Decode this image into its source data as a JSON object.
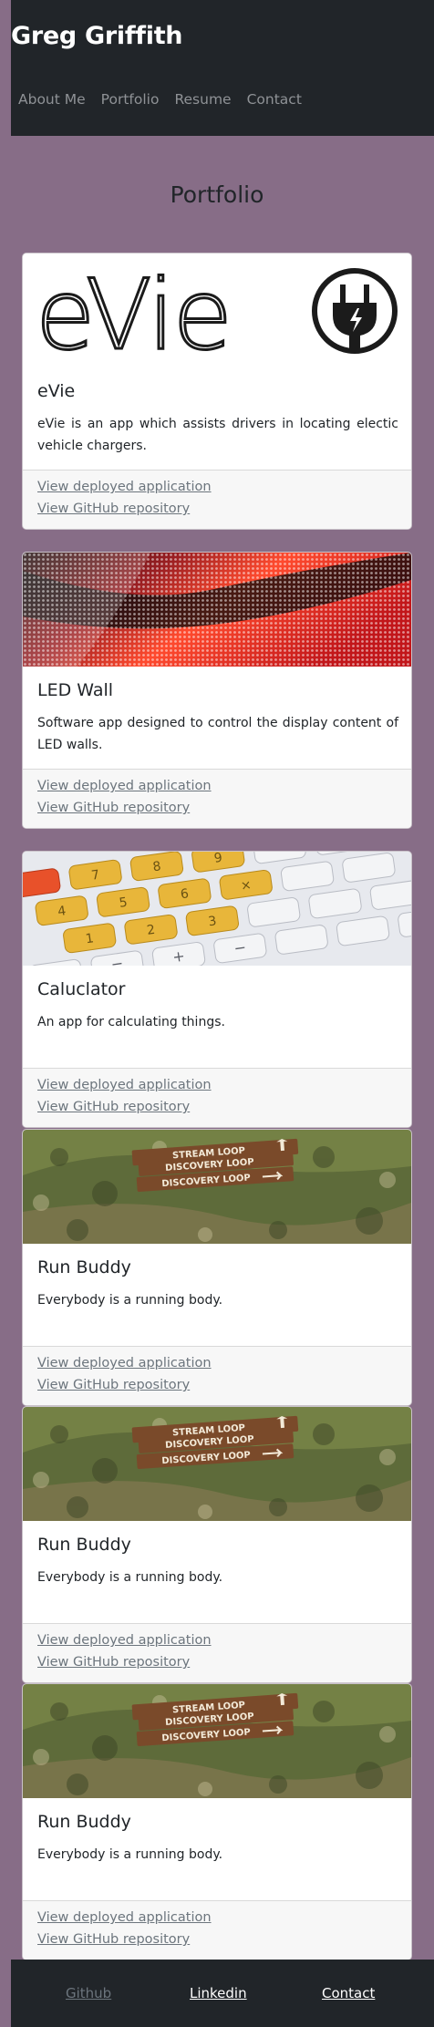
{
  "header": {
    "title": "Greg Griffith",
    "nav": [
      "About Me",
      "Portfolio",
      "Resume",
      "Contact"
    ]
  },
  "section_title": "Portfolio",
  "projects": [
    {
      "title": "eVie",
      "description": "eVie is an app which assists drivers in locating electic vehicle chargers.",
      "image_logo_text": "eVie",
      "image": "evie-logo",
      "deployed_label": "View deployed application",
      "github_label": "View GitHub repository"
    },
    {
      "title": "LED Wall",
      "description": "Software app designed to control the display content of LED walls.",
      "image": "led-wall-photo",
      "deployed_label": "View deployed application",
      "github_label": "View GitHub repository"
    },
    {
      "title": "Caluclator",
      "description": "An app for calculating things.",
      "image": "calculator-keys-photo",
      "deployed_label": "View deployed application",
      "github_label": "View GitHub repository"
    },
    {
      "title": "Run Buddy",
      "description": "Everybody is a running body.",
      "image": "trail-sign-photo",
      "sign_lines": [
        "STREAM LOOP",
        "DISCOVERY LOOP",
        "DISCOVERY LOOP"
      ],
      "deployed_label": "View deployed application",
      "github_label": "View GitHub repository"
    },
    {
      "title": "Run Buddy",
      "description": "Everybody is a running body.",
      "image": "trail-sign-photo",
      "sign_lines": [
        "STREAM LOOP",
        "DISCOVERY LOOP",
        "DISCOVERY LOOP"
      ],
      "deployed_label": "View deployed application",
      "github_label": "View GitHub repository"
    },
    {
      "title": "Run Buddy",
      "description": "Everybody is a running body.",
      "image": "trail-sign-photo",
      "sign_lines": [
        "STREAM LOOP",
        "DISCOVERY LOOP",
        "DISCOVERY LOOP"
      ],
      "deployed_label": "View deployed application",
      "github_label": "View GitHub repository"
    }
  ],
  "footer": {
    "github": "Github",
    "linkedin": "Linkedin",
    "contact": "Contact"
  },
  "colors": {
    "page_background": "#876d87",
    "header_background": "#212529",
    "link_muted": "#6c757d",
    "led_red": "#e0322a",
    "calculator_yellow": "#e8b63a",
    "sign_brown": "#7a4a2a"
  }
}
